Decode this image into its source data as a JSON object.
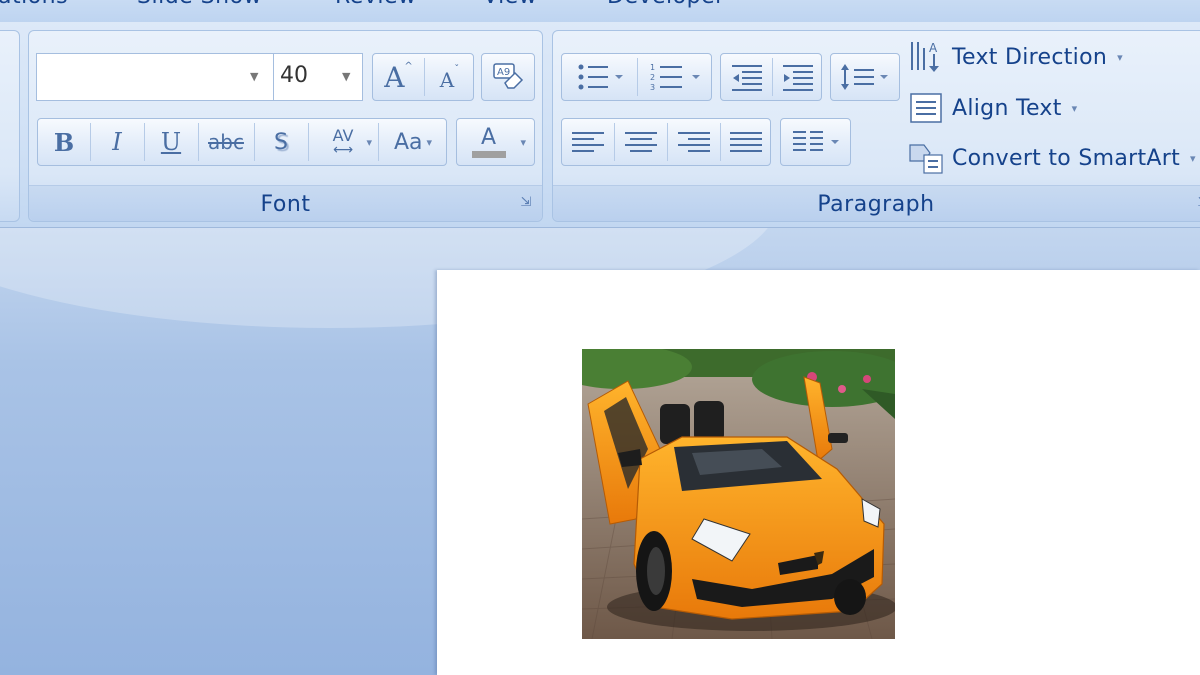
{
  "tabs": [
    "ations",
    "Slide Show",
    "Review",
    "View",
    "Developer"
  ],
  "font_group": {
    "label": "Font",
    "font_name_value": "",
    "font_size_value": "40",
    "grow_font_glyph": "A",
    "shrink_font_glyph": "A",
    "bold_glyph": "B",
    "italic_glyph": "I",
    "underline_glyph": "U",
    "strikethrough_glyph": "abc",
    "shadow_glyph": "S",
    "spacing_glyph": "AV",
    "change_case_glyph": "Aa",
    "font_color_glyph": "A"
  },
  "paragraph_group": {
    "label": "Paragraph",
    "text_direction_label": "Text Direction",
    "align_text_label": "Align Text",
    "smartart_label": "Convert to SmartArt"
  },
  "colors": {
    "ribbon_text": "#15428b",
    "car": "#f39a12"
  }
}
